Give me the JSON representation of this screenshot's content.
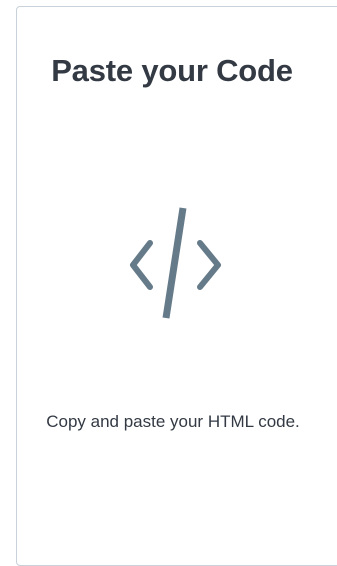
{
  "card": {
    "title": "Paste your Code",
    "icon": "code-icon",
    "description": "Copy and paste your HTML code."
  },
  "colors": {
    "icon": "#667b89",
    "text": "#333a44",
    "border": "#c9d1da"
  }
}
